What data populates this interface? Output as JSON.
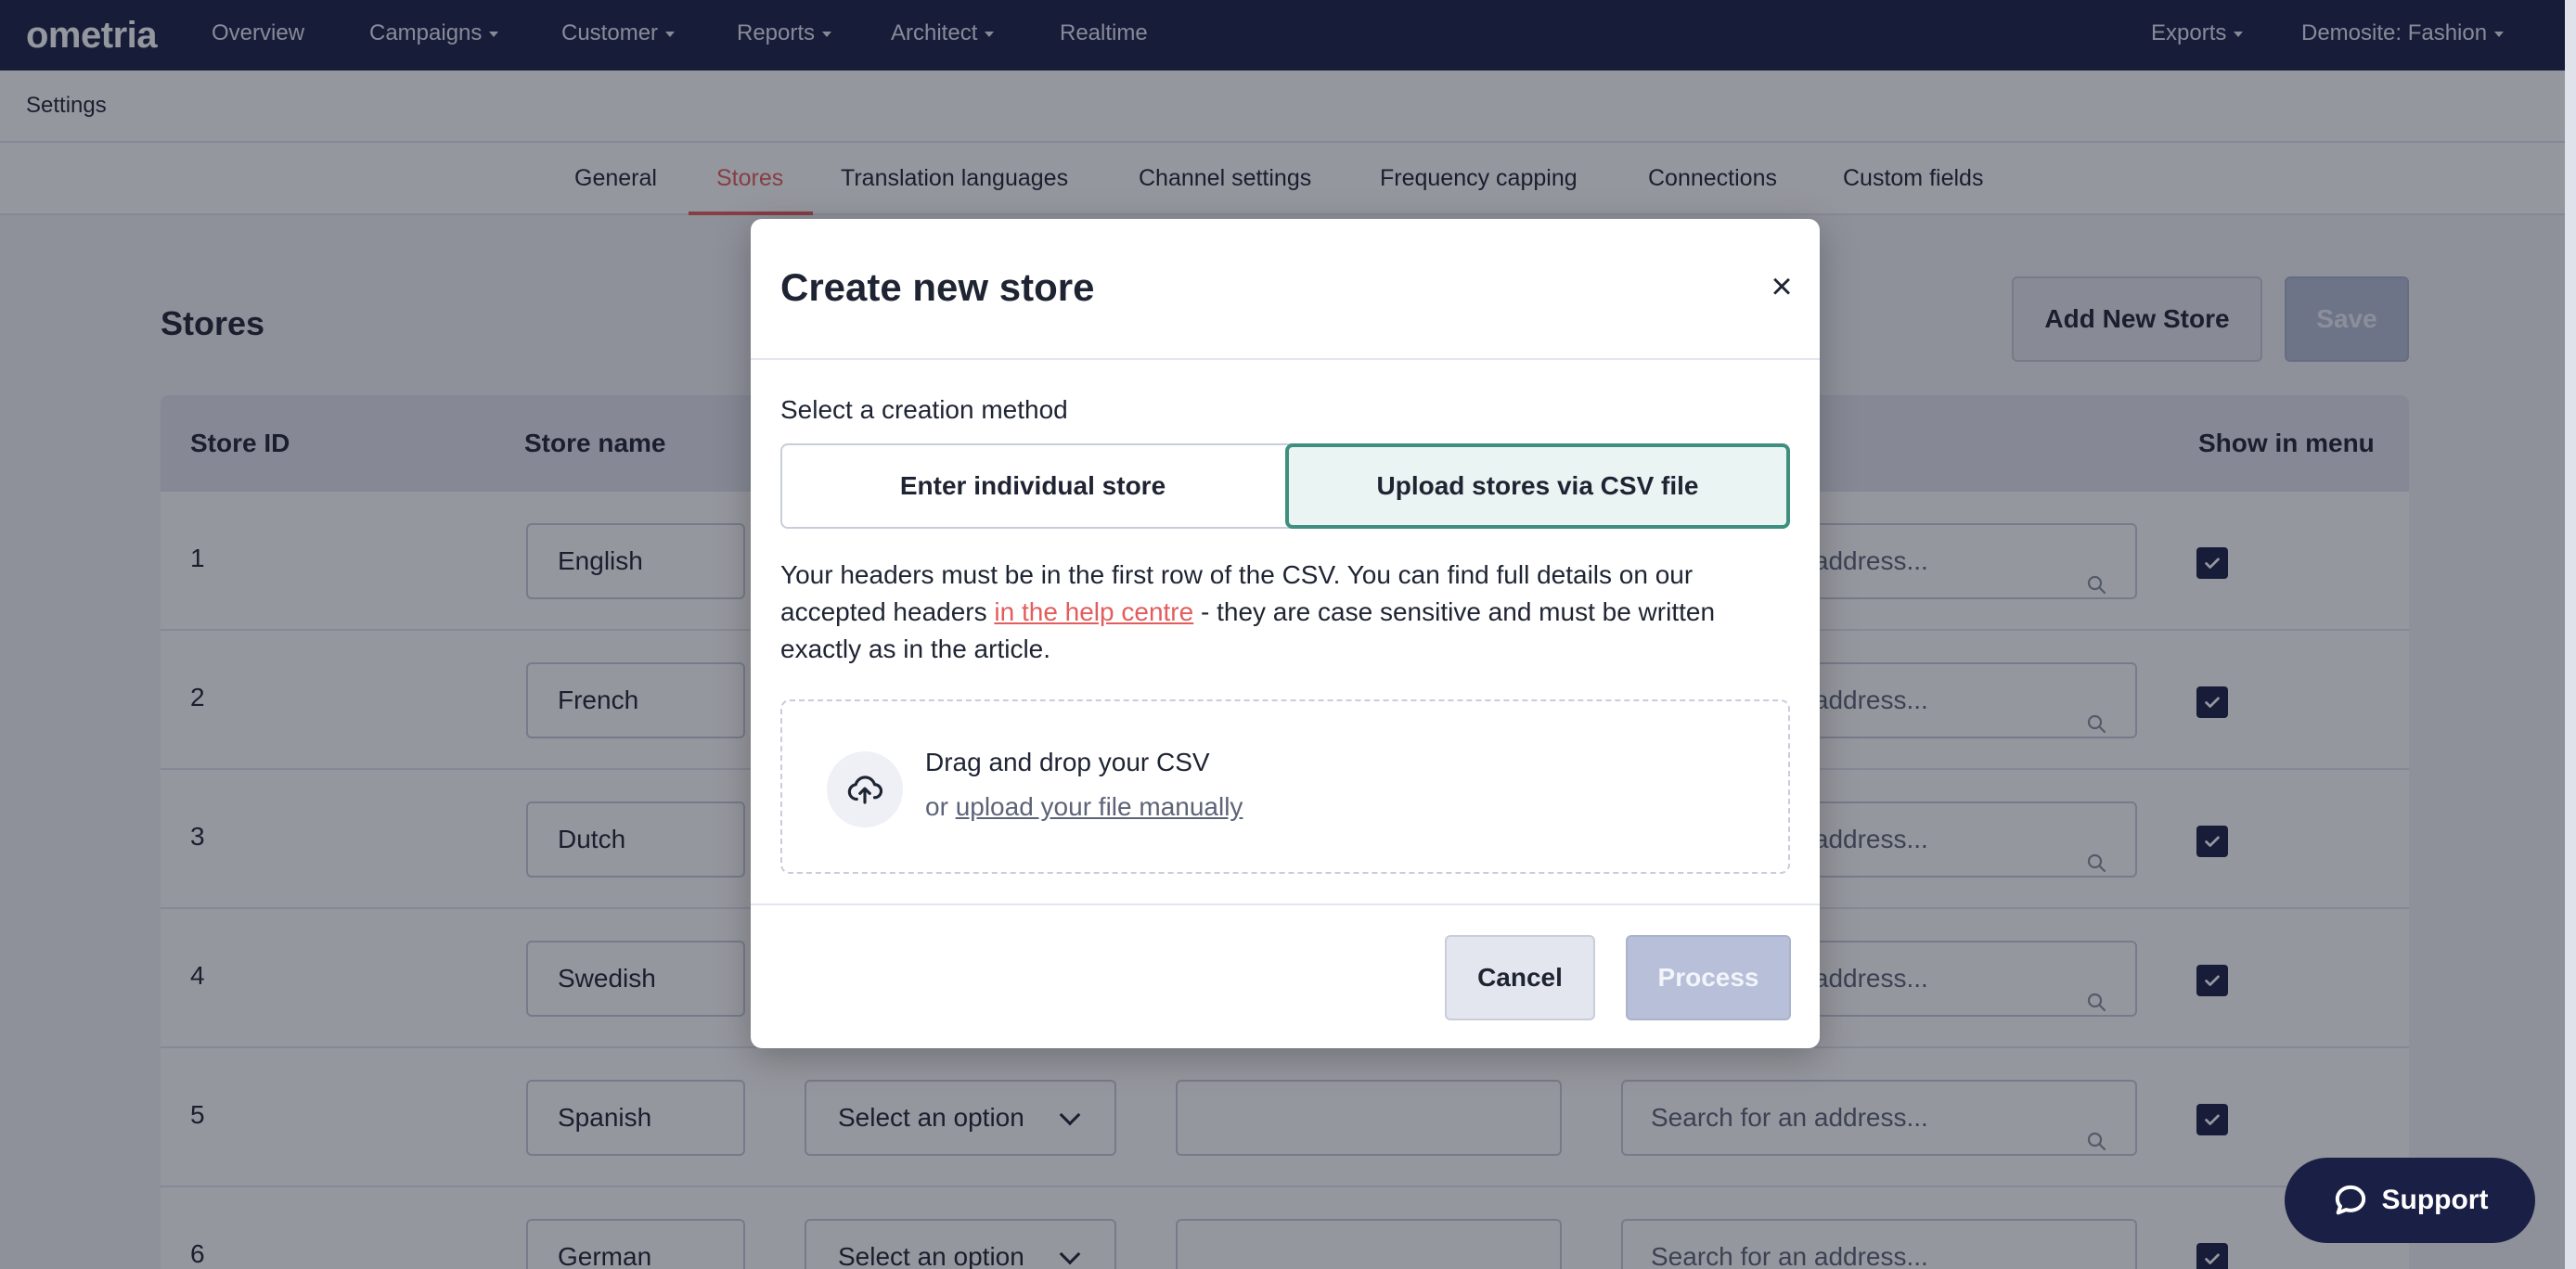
{
  "nav": {
    "logo": "ometria",
    "items": [
      "Overview",
      "Campaigns",
      "Customer",
      "Reports",
      "Architect",
      "Realtime"
    ],
    "right_items": [
      "Exports",
      "Demosite: Fashion"
    ]
  },
  "settings_title": "Settings",
  "tabs": [
    "General",
    "Stores",
    "Translation languages",
    "Channel settings",
    "Frequency capping",
    "Connections",
    "Custom fields"
  ],
  "active_tab": "Stores",
  "page": {
    "title": "Stores",
    "add_button": "Add New Store",
    "save_button": "Save"
  },
  "table": {
    "headers": [
      "Store ID",
      "Store name",
      "Show in menu"
    ],
    "rows": [
      {
        "id": "1",
        "name": "English"
      },
      {
        "id": "2",
        "name": "French"
      },
      {
        "id": "3",
        "name": "Dutch"
      },
      {
        "id": "4",
        "name": "Swedish"
      },
      {
        "id": "5",
        "name": "Spanish"
      },
      {
        "id": "6",
        "name": "German"
      }
    ],
    "select_placeholder": "Select an option",
    "address_placeholder": "Search for an address..."
  },
  "modal": {
    "title": "Create new store",
    "close": "×",
    "method_label": "Select a creation method",
    "option_individual": "Enter individual store",
    "option_csv": "Upload stores via CSV file",
    "desc_part1": "Your headers must be in the first row of the CSV. You can find full details on our accepted headers ",
    "desc_link": "in the help centre",
    "desc_part2": " - they are case sensitive and must be written exactly as in the article.",
    "drop_title": "Drag and drop your CSV",
    "drop_or": "or ",
    "drop_link": "upload your file manually",
    "cancel": "Cancel",
    "process": "Process"
  },
  "support": {
    "label": "Support"
  },
  "colors": {
    "nav_bg": "#1a1f45",
    "accent": "#e35d5d",
    "selected_border": "#3f8f80"
  }
}
